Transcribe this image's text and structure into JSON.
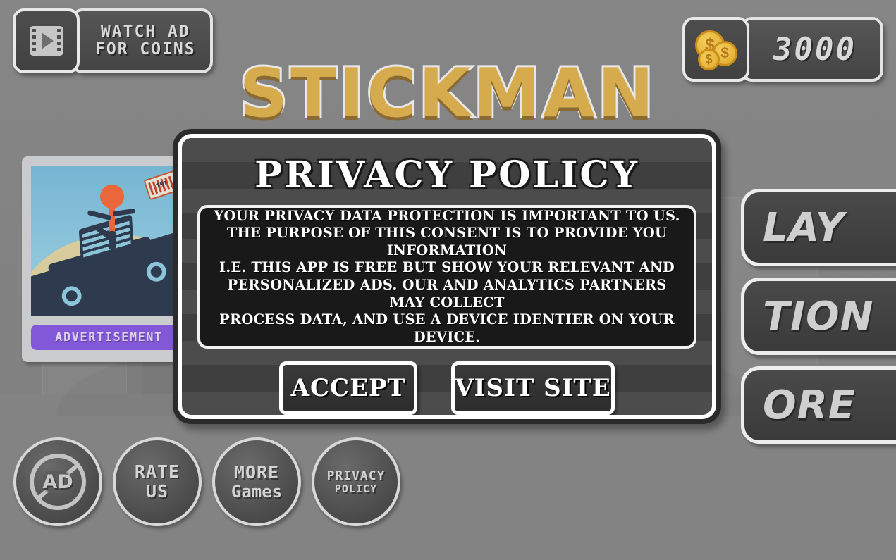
{
  "colors": {
    "background_gray": "#838383",
    "panel_dark": "#3f3f3f",
    "border_white": "#ffffff",
    "title_gold": "#d6ab4e",
    "title_shadow_brown": "#8a6a33",
    "coin_gold": "#e0a62a",
    "ad_banner_purple": "#8358d8",
    "ad_sky_blue": "#7fb9d4",
    "ad_dark_navy": "#2e3a4d",
    "ad_stickman_orange": "#e9673a",
    "body_box_black": "#191919"
  },
  "hud": {
    "watch_ad": {
      "icon": "video-play-icon",
      "line1": "WATCH AD",
      "line2": "FOR COINS"
    },
    "coins": {
      "icon": "coin-stack-icon",
      "symbol": "$",
      "amount": "3000"
    }
  },
  "game_title": "STICKMAN",
  "menu": {
    "buttons": [
      {
        "name": "play",
        "label": "LAY"
      },
      {
        "name": "selection",
        "label": "TION"
      },
      {
        "name": "store",
        "label": "ORE"
      }
    ]
  },
  "advertisement": {
    "banner_label": "ADVERTISEMENT",
    "art_alt": "stickman-jumping-over-truck",
    "tnt_label": "TNT"
  },
  "bottom_buttons": [
    {
      "name": "no-ads",
      "icon": "no-ads-icon",
      "glyph": "AD",
      "line1": "",
      "line2": ""
    },
    {
      "name": "rate-us",
      "icon": "",
      "glyph": "",
      "line1": "RATE",
      "line2": "US"
    },
    {
      "name": "more-games",
      "icon": "",
      "glyph": "",
      "line1": "MORE",
      "line2": "Games"
    },
    {
      "name": "privacy-policy",
      "icon": "",
      "glyph": "",
      "line1": "PRIVACY",
      "line2": "POLICY"
    }
  ],
  "dialog": {
    "title": "PRIVACY POLICY",
    "body_lines": [
      "YOUR PRIVACY DATA PROTECTION IS IMPORTANT TO US.",
      "THE PURPOSE OF THIS CONSENT IS TO PROVIDE YOU INFORMATION",
      "I.E. THIS APP IS FREE BUT SHOW YOUR RELEVANT AND",
      "PERSONALIZED ADS. OUR AND ANALYTICS PARTNERS MAY COLLECT",
      "PROCESS DATA, AND USE A DEVICE IDENTIER ON YOUR DEVICE."
    ],
    "accept_label": "ACCEPT",
    "visit_label": "VISIT SITE"
  }
}
